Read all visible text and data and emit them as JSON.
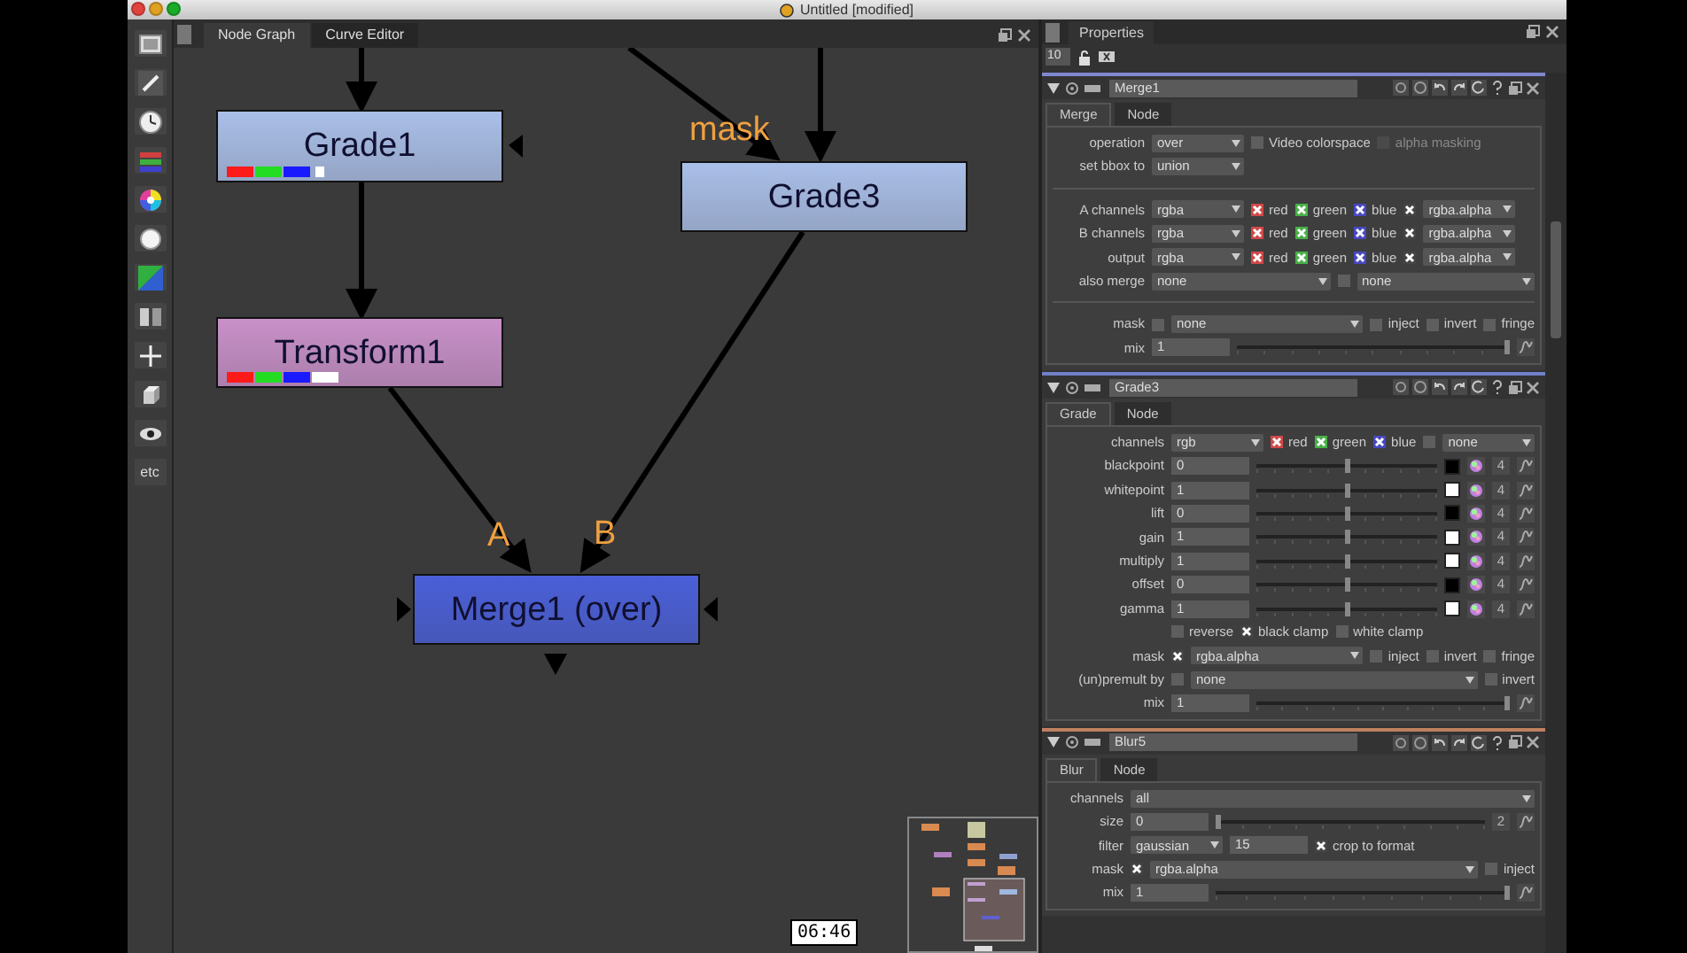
{
  "window": {
    "title": "Untitled [modified]"
  },
  "toolbar": {
    "etc_label": "etc"
  },
  "node_graph": {
    "tabs": [
      {
        "label": "Node Graph",
        "selected": true
      },
      {
        "label": "Curve Editor",
        "selected": false
      }
    ],
    "nodes": [
      {
        "label": "Grade1",
        "color": "#aabfe8",
        "bars": [
          {
            "color": "#ff1a1a"
          },
          {
            "color": "#22dd22"
          },
          {
            "color": "#1a1aff"
          },
          {
            "color": "#ffffff",
            "kind": "dot"
          }
        ]
      },
      {
        "label": "Transform1",
        "color": "#c890c8",
        "bars": [
          {
            "color": "#ff1a1a"
          },
          {
            "color": "#22dd22"
          },
          {
            "color": "#1a1aff"
          },
          {
            "color": "#ffffff"
          }
        ]
      },
      {
        "label": "Grade3",
        "color": "#aabfe8"
      },
      {
        "label": "Merge1 (over)",
        "color": "#4a5fd8"
      }
    ],
    "labels": [
      "mask",
      "A",
      "B"
    ],
    "timecode": "06:46"
  },
  "properties": {
    "tab": "Properties",
    "max_panels": "10",
    "panels": [
      {
        "name": "Merge1",
        "color": "#8088d0",
        "tabs": [
          {
            "label": "Merge",
            "selected": true
          },
          {
            "label": "Node",
            "selected": false
          }
        ],
        "sections": [
          [
            {
              "label": "operation",
              "items": [
                {
                  "kind": "dropdown",
                  "value": "over"
                },
                {
                  "kind": "check",
                  "checked": false,
                  "label": "Video colorspace"
                },
                {
                  "kind": "greyed_check",
                  "checked": false,
                  "label": "alpha masking"
                }
              ]
            },
            {
              "label": "set bbox to",
              "items": [
                {
                  "kind": "dropdown",
                  "value": "union"
                }
              ]
            }
          ],
          [
            {
              "label": "A channels",
              "items": [
                {
                  "kind": "dropdown",
                  "value": "rgba"
                },
                {
                  "kind": "check",
                  "checked": true,
                  "label": "red",
                  "color": "#d04848"
                },
                {
                  "kind": "check",
                  "checked": true,
                  "label": "green",
                  "color": "#48b048"
                },
                {
                  "kind": "check",
                  "checked": true,
                  "label": "blue",
                  "color": "#4848c0"
                },
                {
                  "kind": "check",
                  "checked": true
                },
                {
                  "kind": "dropdown",
                  "value": "rgba.alpha"
                }
              ]
            },
            {
              "label": "B channels",
              "items": [
                {
                  "kind": "dropdown",
                  "value": "rgba"
                },
                {
                  "kind": "check",
                  "checked": true,
                  "label": "red",
                  "color": "#d04848"
                },
                {
                  "kind": "check",
                  "checked": true,
                  "label": "green",
                  "color": "#48b048"
                },
                {
                  "kind": "check",
                  "checked": true,
                  "label": "blue",
                  "color": "#4848c0"
                },
                {
                  "kind": "check",
                  "checked": true
                },
                {
                  "kind": "dropdown",
                  "value": "rgba.alpha"
                }
              ]
            },
            {
              "label": "output",
              "items": [
                {
                  "kind": "dropdown",
                  "value": "rgba"
                },
                {
                  "kind": "check",
                  "checked": true,
                  "label": "red",
                  "color": "#d04848"
                },
                {
                  "kind": "check",
                  "checked": true,
                  "label": "green",
                  "color": "#48b048"
                },
                {
                  "kind": "check",
                  "checked": true,
                  "label": "blue",
                  "color": "#4848c0"
                },
                {
                  "kind": "check",
                  "checked": true
                },
                {
                  "kind": "dropdown",
                  "value": "rgba.alpha"
                }
              ]
            },
            {
              "label": "also merge",
              "items": [
                {
                  "kind": "wide_dropdown",
                  "value": "none"
                },
                {
                  "kind": "check",
                  "checked": false
                },
                {
                  "kind": "wide_dropdown",
                  "value": "none"
                }
              ]
            }
          ],
          [
            {
              "label": "mask",
              "items": [
                {
                  "kind": "check",
                  "checked": false
                },
                {
                  "kind": "wide_dropdown",
                  "value": "none"
                },
                {
                  "kind": "check",
                  "checked": false,
                  "label": "inject"
                },
                {
                  "kind": "check",
                  "checked": false,
                  "label": "invert"
                },
                {
                  "kind": "check",
                  "checked": false,
                  "label": "fringe"
                }
              ]
            },
            {
              "label": "mix",
              "items": [
                {
                  "kind": "field",
                  "value": "1"
                },
                {
                  "kind": "slider",
                  "level": 1
                },
                {
                  "kind": "curve"
                }
              ]
            }
          ]
        ]
      },
      {
        "name": "Grade3",
        "color": "#7080c8",
        "tabs": [
          {
            "label": "Grade",
            "selected": true
          },
          {
            "label": "Node",
            "selected": false
          }
        ],
        "sections": [
          [
            {
              "label": "channels",
              "items": [
                {
                  "kind": "dropdown",
                  "value": "rgb"
                },
                {
                  "kind": "check",
                  "checked": true,
                  "label": "red",
                  "color": "#d04848"
                },
                {
                  "kind": "check",
                  "checked": true,
                  "label": "green",
                  "color": "#48b048"
                },
                {
                  "kind": "check",
                  "checked": true,
                  "label": "blue",
                  "color": "#4848c0"
                },
                {
                  "kind": "check",
                  "checked": false
                },
                {
                  "kind": "dropdown",
                  "value": "none"
                }
              ]
            },
            {
              "label": "blackpoint",
              "items": [
                {
                  "kind": "field",
                  "value": "0"
                },
                {
                  "kind": "slider",
                  "level": 0.5
                },
                {
                  "kind": "swatch",
                  "color": "#000000"
                },
                {
                  "kind": "wheel"
                },
                {
                  "kind": "count",
                  "value": "4"
                },
                {
                  "kind": "curve"
                }
              ]
            },
            {
              "label": "whitepoint",
              "items": [
                {
                  "kind": "field",
                  "value": "1"
                },
                {
                  "kind": "slider",
                  "level": 0.5
                },
                {
                  "kind": "swatch",
                  "color": "#ffffff"
                },
                {
                  "kind": "wheel"
                },
                {
                  "kind": "count",
                  "value": "4"
                },
                {
                  "kind": "curve"
                }
              ]
            },
            {
              "label": "lift",
              "items": [
                {
                  "kind": "field",
                  "value": "0"
                },
                {
                  "kind": "slider",
                  "level": 0.5
                },
                {
                  "kind": "swatch",
                  "color": "#000000"
                },
                {
                  "kind": "wheel"
                },
                {
                  "kind": "count",
                  "value": "4"
                },
                {
                  "kind": "curve"
                }
              ]
            },
            {
              "label": "gain",
              "items": [
                {
                  "kind": "field",
                  "value": "1"
                },
                {
                  "kind": "slider",
                  "level": 0.5
                },
                {
                  "kind": "swatch",
                  "color": "#ffffff"
                },
                {
                  "kind": "wheel"
                },
                {
                  "kind": "count",
                  "value": "4"
                },
                {
                  "kind": "curve"
                }
              ]
            },
            {
              "label": "multiply",
              "items": [
                {
                  "kind": "field",
                  "value": "1"
                },
                {
                  "kind": "slider",
                  "level": 0.5
                },
                {
                  "kind": "swatch",
                  "color": "#ffffff"
                },
                {
                  "kind": "wheel"
                },
                {
                  "kind": "count",
                  "value": "4"
                },
                {
                  "kind": "curve"
                }
              ]
            },
            {
              "label": "offset",
              "items": [
                {
                  "kind": "field",
                  "value": "0"
                },
                {
                  "kind": "slider",
                  "level": 0.5
                },
                {
                  "kind": "swatch",
                  "color": "#000000"
                },
                {
                  "kind": "wheel"
                },
                {
                  "kind": "count",
                  "value": "4"
                },
                {
                  "kind": "curve"
                }
              ]
            },
            {
              "label": "gamma",
              "items": [
                {
                  "kind": "field",
                  "value": "1"
                },
                {
                  "kind": "slider",
                  "level": 0.5
                },
                {
                  "kind": "swatch",
                  "color": "#ffffff"
                },
                {
                  "kind": "wheel"
                },
                {
                  "kind": "count",
                  "value": "4"
                },
                {
                  "kind": "curve"
                }
              ]
            },
            {
              "items": [
                {
                  "kind": "check",
                  "checked": false,
                  "label": "reverse"
                },
                {
                  "kind": "check",
                  "checked": true,
                  "label": "black clamp"
                },
                {
                  "kind": "check",
                  "checked": false,
                  "label": "white clamp"
                }
              ]
            },
            {
              "label": "mask",
              "items": [
                {
                  "kind": "check",
                  "checked": true
                },
                {
                  "kind": "wide_dropdown",
                  "value": "rgba.alpha"
                },
                {
                  "kind": "check",
                  "checked": false,
                  "label": "inject"
                },
                {
                  "kind": "check",
                  "checked": false,
                  "label": "invert"
                },
                {
                  "kind": "check",
                  "checked": false,
                  "label": "fringe"
                }
              ]
            },
            {
              "label": "(un)premult by",
              "items": [
                {
                  "kind": "check",
                  "checked": false
                },
                {
                  "kind": "wide_dropdown",
                  "value": "none"
                },
                {
                  "kind": "check",
                  "checked": false,
                  "label": "invert"
                }
              ]
            },
            {
              "label": "mix",
              "items": [
                {
                  "kind": "field",
                  "value": "1"
                },
                {
                  "kind": "slider",
                  "level": 1
                },
                {
                  "kind": "curve"
                }
              ]
            }
          ]
        ]
      },
      {
        "name": "Blur5",
        "color": "#c08060",
        "tabs": [
          {
            "label": "Blur",
            "selected": true
          },
          {
            "label": "Node",
            "selected": false
          }
        ],
        "sections": [
          [
            {
              "label": "channels",
              "items": [
                {
                  "kind": "wide_dropdown",
                  "value": "all"
                }
              ]
            },
            {
              "label": "size",
              "items": [
                {
                  "kind": "field",
                  "value": "0"
                },
                {
                  "kind": "slider",
                  "level": 0
                },
                {
                  "kind": "count",
                  "value": "2"
                },
                {
                  "kind": "curve"
                }
              ]
            },
            {
              "label": "filter",
              "items": [
                {
                  "kind": "dropdown",
                  "value": "gaussian"
                },
                {
                  "kind": "field",
                  "value": "15"
                },
                {
                  "kind": "check",
                  "checked": true,
                  "label": "crop to format"
                }
              ]
            },
            {
              "label": "mask",
              "items": [
                {
                  "kind": "check",
                  "checked": true
                },
                {
                  "kind": "wide_dropdown",
                  "value": "rgba.alpha"
                },
                {
                  "kind": "check",
                  "checked": false,
                  "label": "inject"
                }
              ]
            },
            {
              "label": "mix",
              "items": [
                {
                  "kind": "field",
                  "value": "1"
                },
                {
                  "kind": "slider",
                  "level": 1
                },
                {
                  "kind": "curve"
                }
              ]
            }
          ]
        ]
      }
    ]
  }
}
